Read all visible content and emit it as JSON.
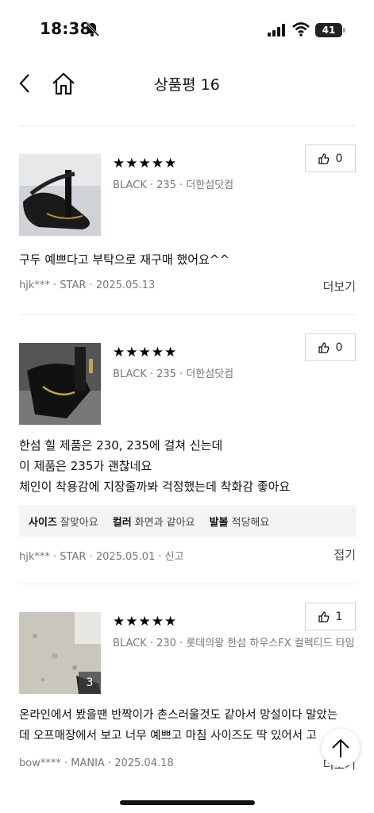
{
  "status_bar": {
    "time": "18:38",
    "battery": "41"
  },
  "header": {
    "title": "상품평 16"
  },
  "reviews": [
    {
      "rating": "★★★★★",
      "option": "BLACK · 235 · 더한섬닷컴",
      "likes": "0",
      "text_lines": [
        "구두 예쁘다고 부탁으로 재구매 했어요^^"
      ],
      "user": "hjk***",
      "grade": "STAR",
      "date": "2025.05.13",
      "action": "더보기"
    },
    {
      "rating": "★★★★★",
      "option": "BLACK · 235 · 더한섬닷컴",
      "likes": "0",
      "text_lines": [
        "한섬 힐 제품은 230, 235에 걸쳐 신는데",
        "이 제품은 235가 괜찮네요",
        "체인이 착용감에 지장줄까봐 걱정했는데 착화감 좋아요"
      ],
      "tags": [
        {
          "label": "사이즈",
          "value": "잘맞아요"
        },
        {
          "label": "컬러",
          "value": "화면과 같아요"
        },
        {
          "label": "발볼",
          "value": "적당해요"
        }
      ],
      "user": "hjk***",
      "grade": "STAR",
      "date": "2025.05.01",
      "report": "신고",
      "action": "접기"
    },
    {
      "rating": "★★★★★",
      "option": "BLACK · 230 · 롯데의왕 한섬 하우스FX 컬렉티드 타임",
      "likes": "1",
      "photo_count": "3",
      "text_lines": [
        "온라인에서 봤을땐 반짝이가 촌스러울것도 같아서 망설이다 말았는",
        "데 오프매장에서 보고 너무 예쁘고 마침 사이즈도 딱 있어서 고"
      ],
      "user": "bow****",
      "grade": "MANIA",
      "date": "2025.04.18",
      "action": "더보기"
    }
  ]
}
